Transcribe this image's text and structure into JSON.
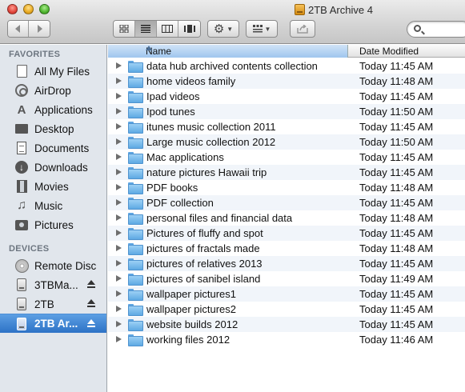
{
  "window": {
    "title": "2TB Archive 4"
  },
  "toolbar": {
    "back_icon": "chevron-left-icon",
    "forward_icon": "chevron-right-icon",
    "view_modes": [
      "icon-view-icon",
      "list-view-icon",
      "column-view-icon",
      "coverflow-view-icon"
    ],
    "active_view": "list-view-icon",
    "action_icon": "gear-icon",
    "arrange_icon": "arrange-grid-icon",
    "share_icon": "share-icon",
    "search_placeholder": ""
  },
  "sidebar": {
    "favorites_header": "FAVORITES",
    "favorites": [
      {
        "label": "All My Files",
        "icon": "all-files-icon"
      },
      {
        "label": "AirDrop",
        "icon": "airdrop-icon"
      },
      {
        "label": "Applications",
        "icon": "applications-icon"
      },
      {
        "label": "Desktop",
        "icon": "desktop-icon"
      },
      {
        "label": "Documents",
        "icon": "documents-icon"
      },
      {
        "label": "Downloads",
        "icon": "downloads-icon"
      },
      {
        "label": "Movies",
        "icon": "movies-icon"
      },
      {
        "label": "Music",
        "icon": "music-icon"
      },
      {
        "label": "Pictures",
        "icon": "pictures-icon"
      }
    ],
    "devices_header": "DEVICES",
    "devices": [
      {
        "label": "Remote Disc",
        "icon": "disc-icon",
        "eject": false,
        "selected": false
      },
      {
        "label": "3TBMa...",
        "icon": "hard-drive-icon",
        "eject": true,
        "selected": false
      },
      {
        "label": "2TB",
        "icon": "hard-drive-icon",
        "eject": true,
        "selected": false
      },
      {
        "label": "2TB Ar...",
        "icon": "hard-drive-icon",
        "eject": true,
        "selected": true
      }
    ]
  },
  "list": {
    "columns": {
      "name": "Name",
      "date": "Date Modified"
    },
    "rows": [
      {
        "name": "data hub archived contents collection",
        "date": "Today 11:45 AM"
      },
      {
        "name": "home videos family",
        "date": "Today 11:48 AM"
      },
      {
        "name": "Ipad videos",
        "date": "Today 11:45 AM"
      },
      {
        "name": "Ipod tunes",
        "date": "Today 11:50 AM"
      },
      {
        "name": "itunes music collection 2011",
        "date": "Today 11:45 AM"
      },
      {
        "name": "Large music collection 2012",
        "date": "Today 11:50 AM"
      },
      {
        "name": "Mac applications",
        "date": "Today 11:45 AM"
      },
      {
        "name": "nature pictures Hawaii trip",
        "date": "Today 11:45 AM"
      },
      {
        "name": "PDF books",
        "date": "Today 11:48 AM"
      },
      {
        "name": "PDF collection",
        "date": "Today 11:45 AM"
      },
      {
        "name": "personal files and financial data",
        "date": "Today 11:48 AM"
      },
      {
        "name": "Pictures of fluffy and spot",
        "date": "Today 11:45 AM"
      },
      {
        "name": "pictures of fractals made",
        "date": "Today 11:48 AM"
      },
      {
        "name": "pictures of relatives 2013",
        "date": "Today 11:45 AM"
      },
      {
        "name": "pictures of sanibel island",
        "date": "Today 11:49 AM"
      },
      {
        "name": "wallpaper pictures1",
        "date": "Today 11:45 AM"
      },
      {
        "name": "wallpaper pictures2",
        "date": "Today 11:45 AM"
      },
      {
        "name": "website builds 2012",
        "date": "Today 11:45 AM"
      },
      {
        "name": "working files 2012",
        "date": "Today 11:46 AM"
      }
    ]
  }
}
